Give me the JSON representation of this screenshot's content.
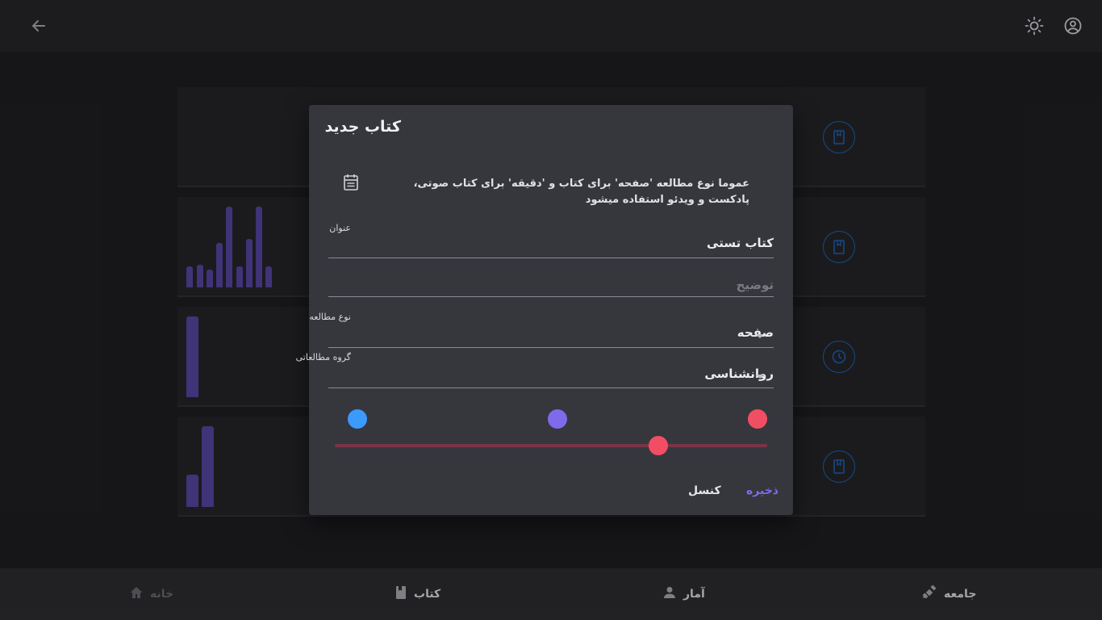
{
  "topbar": {
    "back_icon": "arrow-back-icon",
    "theme_icon": "sun-icon",
    "account_icon": "account-circle-icon"
  },
  "cards": [
    {
      "icon": "bookmark-book-icon"
    },
    {
      "icon": "bookmark-book-icon"
    },
    {
      "icon": "clock-icon"
    },
    {
      "icon": "bookmark-book-icon"
    }
  ],
  "dialog": {
    "title": "کتاب جدید",
    "info_text": "عموما نوع مطالعه 'صفحه' برای کتاب و 'دقیقه' برای کتاب صوتی، پادکست و ویدئو استفاده میشود",
    "info_icon": "calendar-note-icon",
    "fields": {
      "title": {
        "label": "عنوان",
        "value": "کتاب تستی"
      },
      "description": {
        "placeholder": "توضیح",
        "value": ""
      },
      "study_type": {
        "label": "نوع مطالعه",
        "value": "صفحه"
      },
      "study_group": {
        "label": "گروه مطالعاتی",
        "value": "روانشناسی"
      }
    },
    "colors": {
      "swatches": [
        "#f24e63",
        "#7f6bea",
        "#3b9afc"
      ],
      "slider_track": "#7a3447",
      "slider_thumb": "#f24e63"
    },
    "slider_value_fraction": 0.75,
    "buttons": {
      "save": "ذخیره",
      "cancel": "کنسل"
    }
  },
  "bottom_nav": [
    {
      "label": "جامعه",
      "icon": "satellite-icon"
    },
    {
      "label": "آمار",
      "icon": "person-icon"
    },
    {
      "label": "کتاب",
      "icon": "book-icon"
    },
    {
      "label": "خانه",
      "icon": "home-icon"
    }
  ],
  "accent_color": "#7f6bea",
  "card_icon_color": "#1c5aa8"
}
